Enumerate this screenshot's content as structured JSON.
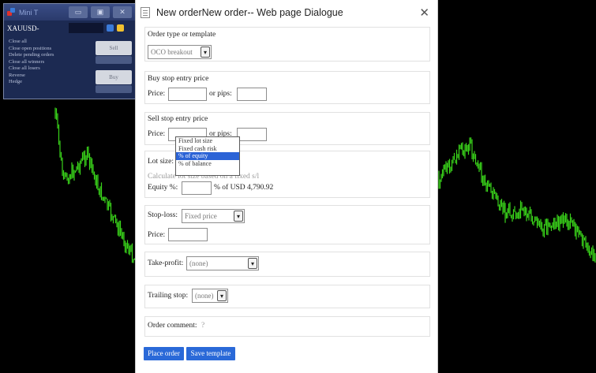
{
  "mini_terminal": {
    "title": "Mini T",
    "symbol": "XAUUSD-",
    "menu": [
      "Close all",
      "Close open positions",
      "Delete pending orders",
      "Close all winners",
      "Close all losers",
      "Reverse",
      "Hedge"
    ],
    "side_buttons": [
      "Sell",
      "Buy"
    ],
    "window_buttons": [
      "minimize-icon",
      "restore-icon",
      "close-icon"
    ],
    "colors": {
      "accent_red": "#e0302a",
      "accent_blue": "#3b7bd9",
      "yellow": "#f2c12e"
    }
  },
  "dialog": {
    "title": "New orderNew order-- Web page Dialogue",
    "order_type": {
      "label": "Order type or template",
      "selected": "OCO breakout"
    },
    "buy_stop": {
      "label": "Buy stop entry price",
      "price_label": "Price:",
      "pips_label": "or pips:"
    },
    "sell_stop": {
      "label": "Sell stop entry price",
      "price_label": "Price:",
      "pips_label": "or pips:"
    },
    "lot_size": {
      "label": "Lot size:",
      "dropdown_options": [
        "Fixed lot size",
        "Fixed cash risk",
        "% of equity",
        "% of balance"
      ],
      "selected_index": 2,
      "note": "Calculate lot size based on a fixed s/l",
      "equity_label": "Equity %:",
      "equity_suffix": "% of USD 4,790.92"
    },
    "stop_loss": {
      "label": "Stop-loss:",
      "selected": "Fixed price",
      "price_label": "Price:"
    },
    "take_profit": {
      "label": "Take-profit:",
      "selected": "(none)"
    },
    "trailing_stop": {
      "label": "Trailing stop:",
      "selected": "(none)"
    },
    "order_comment": {
      "label": "Order comment:",
      "hint": "?"
    },
    "buttons": {
      "place_order": "Place order",
      "save_template": "Save template"
    },
    "accent": "#2a69d8"
  },
  "chart": {
    "line_color": "#39d31a",
    "background": "#000000"
  }
}
